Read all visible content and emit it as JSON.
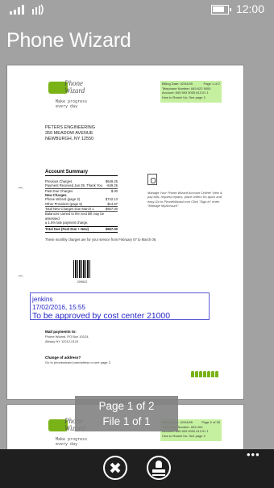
{
  "status_bar": {
    "time": "12:00"
  },
  "app": {
    "title": "Phone Wizard"
  },
  "document": {
    "logo_text": "Phone Wizard",
    "tagline": "Make progress every day",
    "info_box": {
      "billing_date": "Billing Date: 02/04/05",
      "page": "Page 1 of 2",
      "telephone": "Telephone Number: 845 622 9000",
      "account": "Account: 845 553 9000 613 01 1",
      "how_to_reach": "How to Reach Us: See page 2"
    },
    "address_lines": [
      "PETERS ENGINEERING",
      "350 MEADOW AVENUE",
      "NEWBURGH, NY 12550"
    ],
    "account_summary": {
      "title": "Account Summary",
      "rows": [
        {
          "label": "Previous Charges",
          "value": "$649.25"
        },
        {
          "label": "Payment Received Jan 29, Thank You",
          "value": "-649.25"
        },
        {
          "label": "Past Due Charges",
          "value": "$.00"
        },
        {
          "label": "New Charges",
          "value": ""
        },
        {
          "label": "Phone Wizard (page 3)",
          "value": "$742.13"
        },
        {
          "label": "Other Providers (page 5)",
          "value": "$14.87"
        },
        {
          "label": "Total New Charges Due March 1",
          "value": "$657.00"
        },
        {
          "label": "Balances carried to the next bill may be assessed",
          "value": ""
        },
        {
          "label": "a 1.5% late payment charge.",
          "value": ""
        },
        {
          "label": "Total Due (Past Due + New)",
          "value": "$657.00"
        }
      ]
    },
    "manage_text": "Manage Your Phone Wizard Account Online! View & pay bills, request repairs, place orders It's quick and easy Go to PhoneWizard.com Click \"Sign in\" enter \"Manage MyAccount\"",
    "note_text": "These monthly charges are for your service from February 07 to March 06.",
    "barcode_number": "209622",
    "stamp": {
      "user": "jenkins",
      "datetime": "17/02/2016, 15:55",
      "message": "To be approved by cost center 21000"
    },
    "mail_payments_title": "Mail payments to:",
    "mail_payments_lines": [
      "Phone Wizard, PO Box 10124,",
      "Albany NY 12212-0124"
    ],
    "change_address_title": "Change of address?",
    "change_address_text": "Go to phonewizard.com/adress or see page 2.",
    "page2_info_box": {
      "billing_date": "Billing Date: 02/04/05",
      "page": "Page 2 of 35",
      "telephone": "Telephone Number: 845 400",
      "account": "Account: 845 553 9000 613 01 1",
      "how_to_reach": "How to Reach Us: See page 2"
    }
  },
  "overlay": {
    "page_label": "Page 1 of 2",
    "file_label": "File 1 of 1"
  },
  "app_bar": {
    "more": "•••"
  }
}
